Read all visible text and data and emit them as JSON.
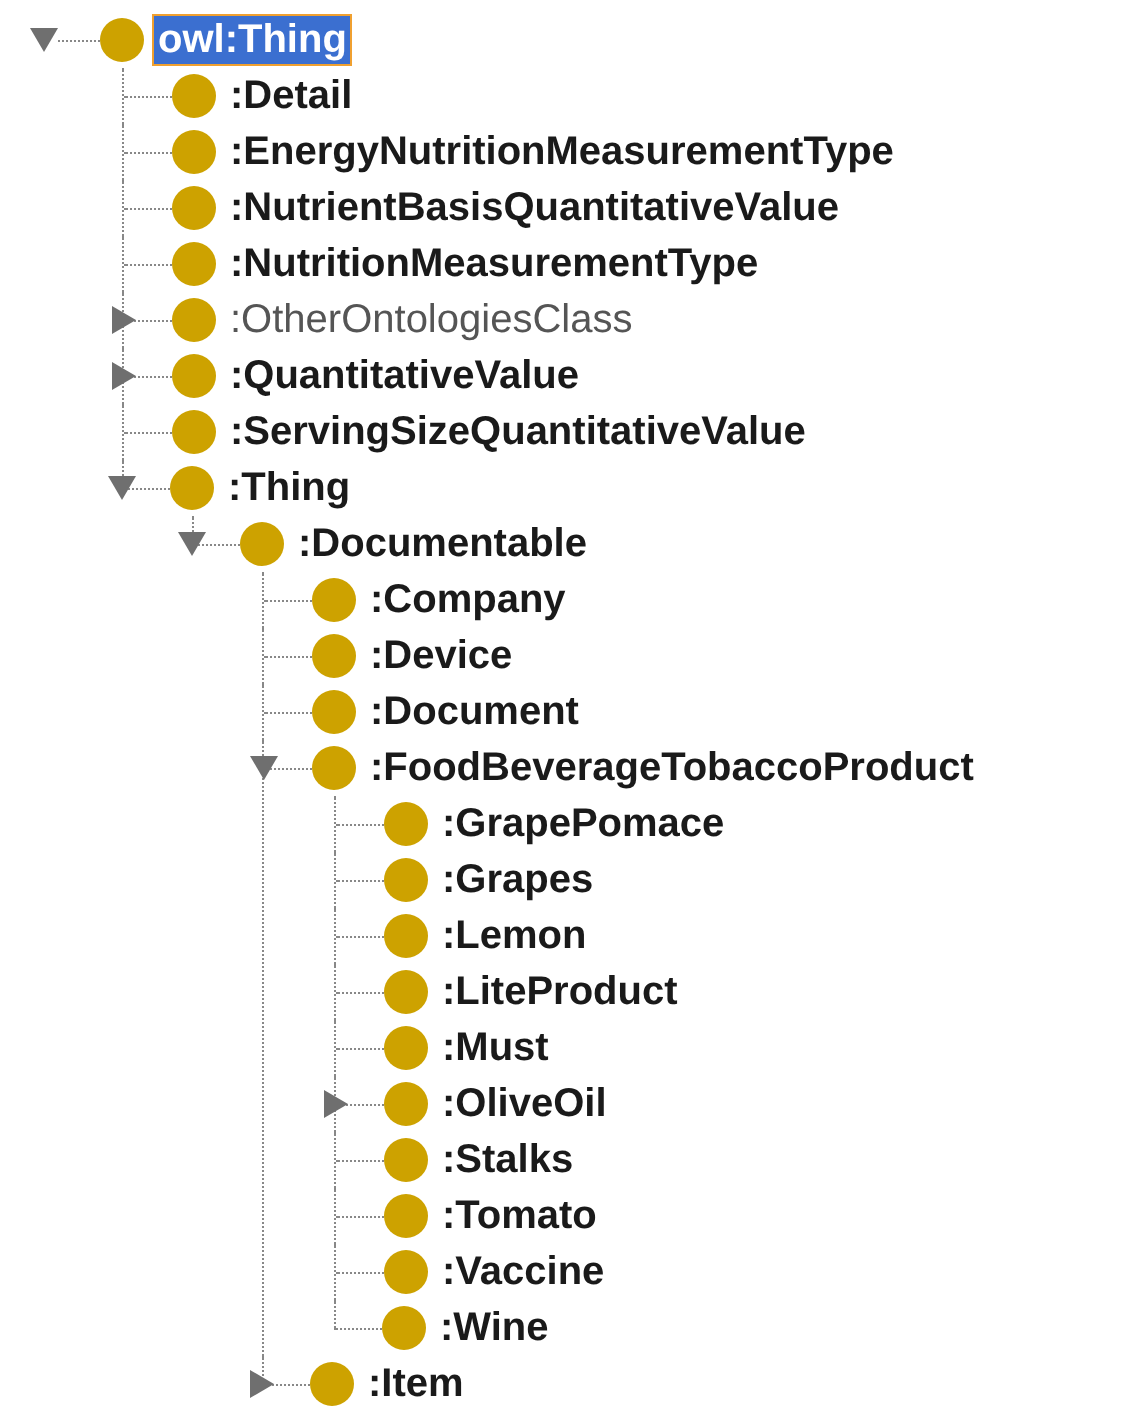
{
  "tree": {
    "label": "owl:Thing",
    "bold": true,
    "selected": true,
    "expanded": true,
    "children": [
      {
        "label": ":Detail",
        "bold": true,
        "selected": false
      },
      {
        "label": ":EnergyNutritionMeasurementType",
        "bold": true,
        "selected": false
      },
      {
        "label": ":NutrientBasisQuantitativeValue",
        "bold": true,
        "selected": false
      },
      {
        "label": ":NutritionMeasurementType",
        "bold": true,
        "selected": false
      },
      {
        "label": ":OtherOntologiesClass",
        "bold": false,
        "selected": false,
        "expanded": false
      },
      {
        "label": ":QuantitativeValue",
        "bold": true,
        "selected": false,
        "expanded": false
      },
      {
        "label": ":ServingSizeQuantitativeValue",
        "bold": true,
        "selected": false
      },
      {
        "label": ":Thing",
        "bold": true,
        "selected": false,
        "expanded": true,
        "children": [
          {
            "label": ":Documentable",
            "bold": true,
            "selected": false,
            "expanded": true,
            "children": [
              {
                "label": ":Company",
                "bold": true,
                "selected": false
              },
              {
                "label": ":Device",
                "bold": true,
                "selected": false
              },
              {
                "label": ":Document",
                "bold": true,
                "selected": false
              },
              {
                "label": ":FoodBeverageTobaccoProduct",
                "bold": true,
                "selected": false,
                "expanded": true,
                "children": [
                  {
                    "label": ":GrapePomace",
                    "bold": true,
                    "selected": false
                  },
                  {
                    "label": ":Grapes",
                    "bold": true,
                    "selected": false
                  },
                  {
                    "label": ":Lemon",
                    "bold": true,
                    "selected": false
                  },
                  {
                    "label": ":LiteProduct",
                    "bold": true,
                    "selected": false
                  },
                  {
                    "label": ":Must",
                    "bold": true,
                    "selected": false
                  },
                  {
                    "label": ":OliveOil",
                    "bold": true,
                    "selected": false,
                    "expanded": false
                  },
                  {
                    "label": ":Stalks",
                    "bold": true,
                    "selected": false
                  },
                  {
                    "label": ":Tomato",
                    "bold": true,
                    "selected": false
                  },
                  {
                    "label": ":Vaccine",
                    "bold": true,
                    "selected": false
                  },
                  {
                    "label": ":Wine",
                    "bold": true,
                    "selected": false
                  }
                ]
              },
              {
                "label": ":Item",
                "bold": true,
                "selected": false,
                "expanded": false
              }
            ]
          }
        ]
      }
    ]
  }
}
